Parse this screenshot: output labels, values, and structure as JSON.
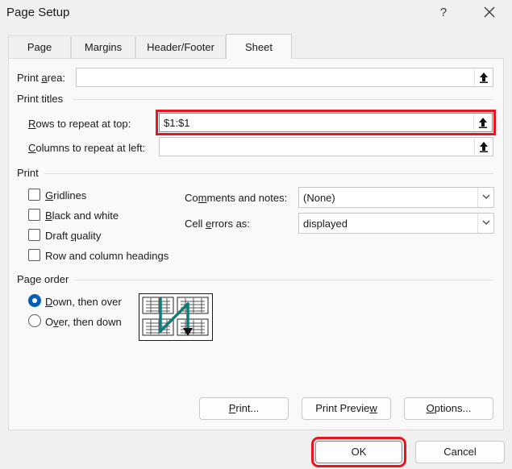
{
  "window": {
    "title": "Page Setup",
    "help_label": "?"
  },
  "tabs": [
    {
      "label": "Page"
    },
    {
      "label": "Margins"
    },
    {
      "label": "Header/Footer"
    },
    {
      "label": "Sheet",
      "active": true
    }
  ],
  "print_area": {
    "label_pre": "Print ",
    "label_key": "a",
    "label_post": "rea:",
    "value": ""
  },
  "print_titles": {
    "heading": "Print titles",
    "rows_label_key": "R",
    "rows_label_post": "ows to repeat at top:",
    "rows_value": "$1:$1",
    "cols_label_key": "C",
    "cols_label_post": "olumns to repeat at left:",
    "cols_value": ""
  },
  "print": {
    "heading": "Print",
    "gridlines": {
      "key": "G",
      "post": "ridlines",
      "checked": false
    },
    "black_white": {
      "key": "B",
      "post": "lack and white",
      "checked": false
    },
    "draft": {
      "pre": "Draft ",
      "key": "q",
      "post": "uality",
      "checked": false
    },
    "row_col": {
      "label": "Row and column headings",
      "checked": false
    },
    "comments": {
      "label_pre": "Co",
      "label_key": "m",
      "label_post": "ments and notes:",
      "value": "(None)"
    },
    "errors": {
      "label_pre": "Cell ",
      "label_key": "e",
      "label_post": "rrors as:",
      "value": "displayed"
    }
  },
  "page_order": {
    "heading": "Page order",
    "down_then_over": {
      "key": "D",
      "post": "own, then over",
      "selected": true
    },
    "over_then_down": {
      "pre": "O",
      "key": "v",
      "post": "er, then down",
      "selected": false
    }
  },
  "buttons": {
    "print": {
      "key": "P",
      "post": "rint..."
    },
    "preview": {
      "pre": "Print Previe",
      "key": "w",
      "post": ""
    },
    "options": {
      "key": "O",
      "post": "ptions..."
    },
    "ok": "OK",
    "cancel": "Cancel"
  },
  "colors": {
    "highlight": "#e8151f",
    "accent": "#005fb8",
    "arrow": "#0e7c7b"
  }
}
